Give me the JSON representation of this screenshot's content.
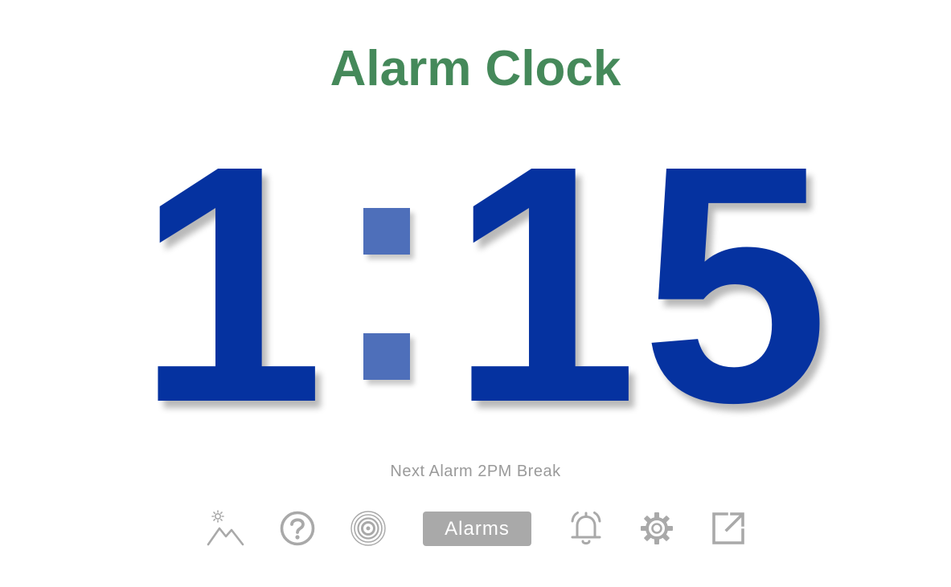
{
  "title": "Alarm Clock",
  "clock": {
    "hours": "1",
    "minutes": "15",
    "separator": ":"
  },
  "next_alarm": {
    "prefix": "Next Alarm",
    "time": "2PM",
    "label": "Break"
  },
  "toolbar": {
    "alarms_label": "Alarms",
    "icons": [
      "landscape-sun-icon",
      "help-icon",
      "ripple-icon",
      "bell-icon",
      "gear-icon",
      "external-link-icon"
    ]
  },
  "colors": {
    "title": "#45895a",
    "digits": "#0532a0",
    "colon": "#4e6fba",
    "muted": "#9a9a9a",
    "icon": "#a9a9a9"
  }
}
